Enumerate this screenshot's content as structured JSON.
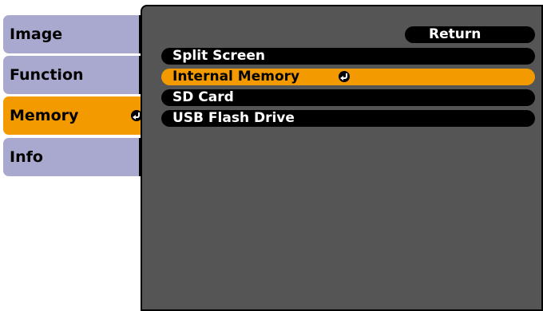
{
  "sidebar": {
    "tabs": [
      {
        "label": "Image"
      },
      {
        "label": "Function"
      },
      {
        "label": "Memory"
      },
      {
        "label": "Info"
      }
    ]
  },
  "panel": {
    "return_label": "Return",
    "items": [
      {
        "label": "Split Screen"
      },
      {
        "label": "Internal Memory"
      },
      {
        "label": "SD Card"
      },
      {
        "label": "USB Flash Drive"
      }
    ]
  },
  "colors": {
    "accent": "#f29a00",
    "tab_inactive": "#a9a9cf",
    "panel_bg": "#555555"
  }
}
